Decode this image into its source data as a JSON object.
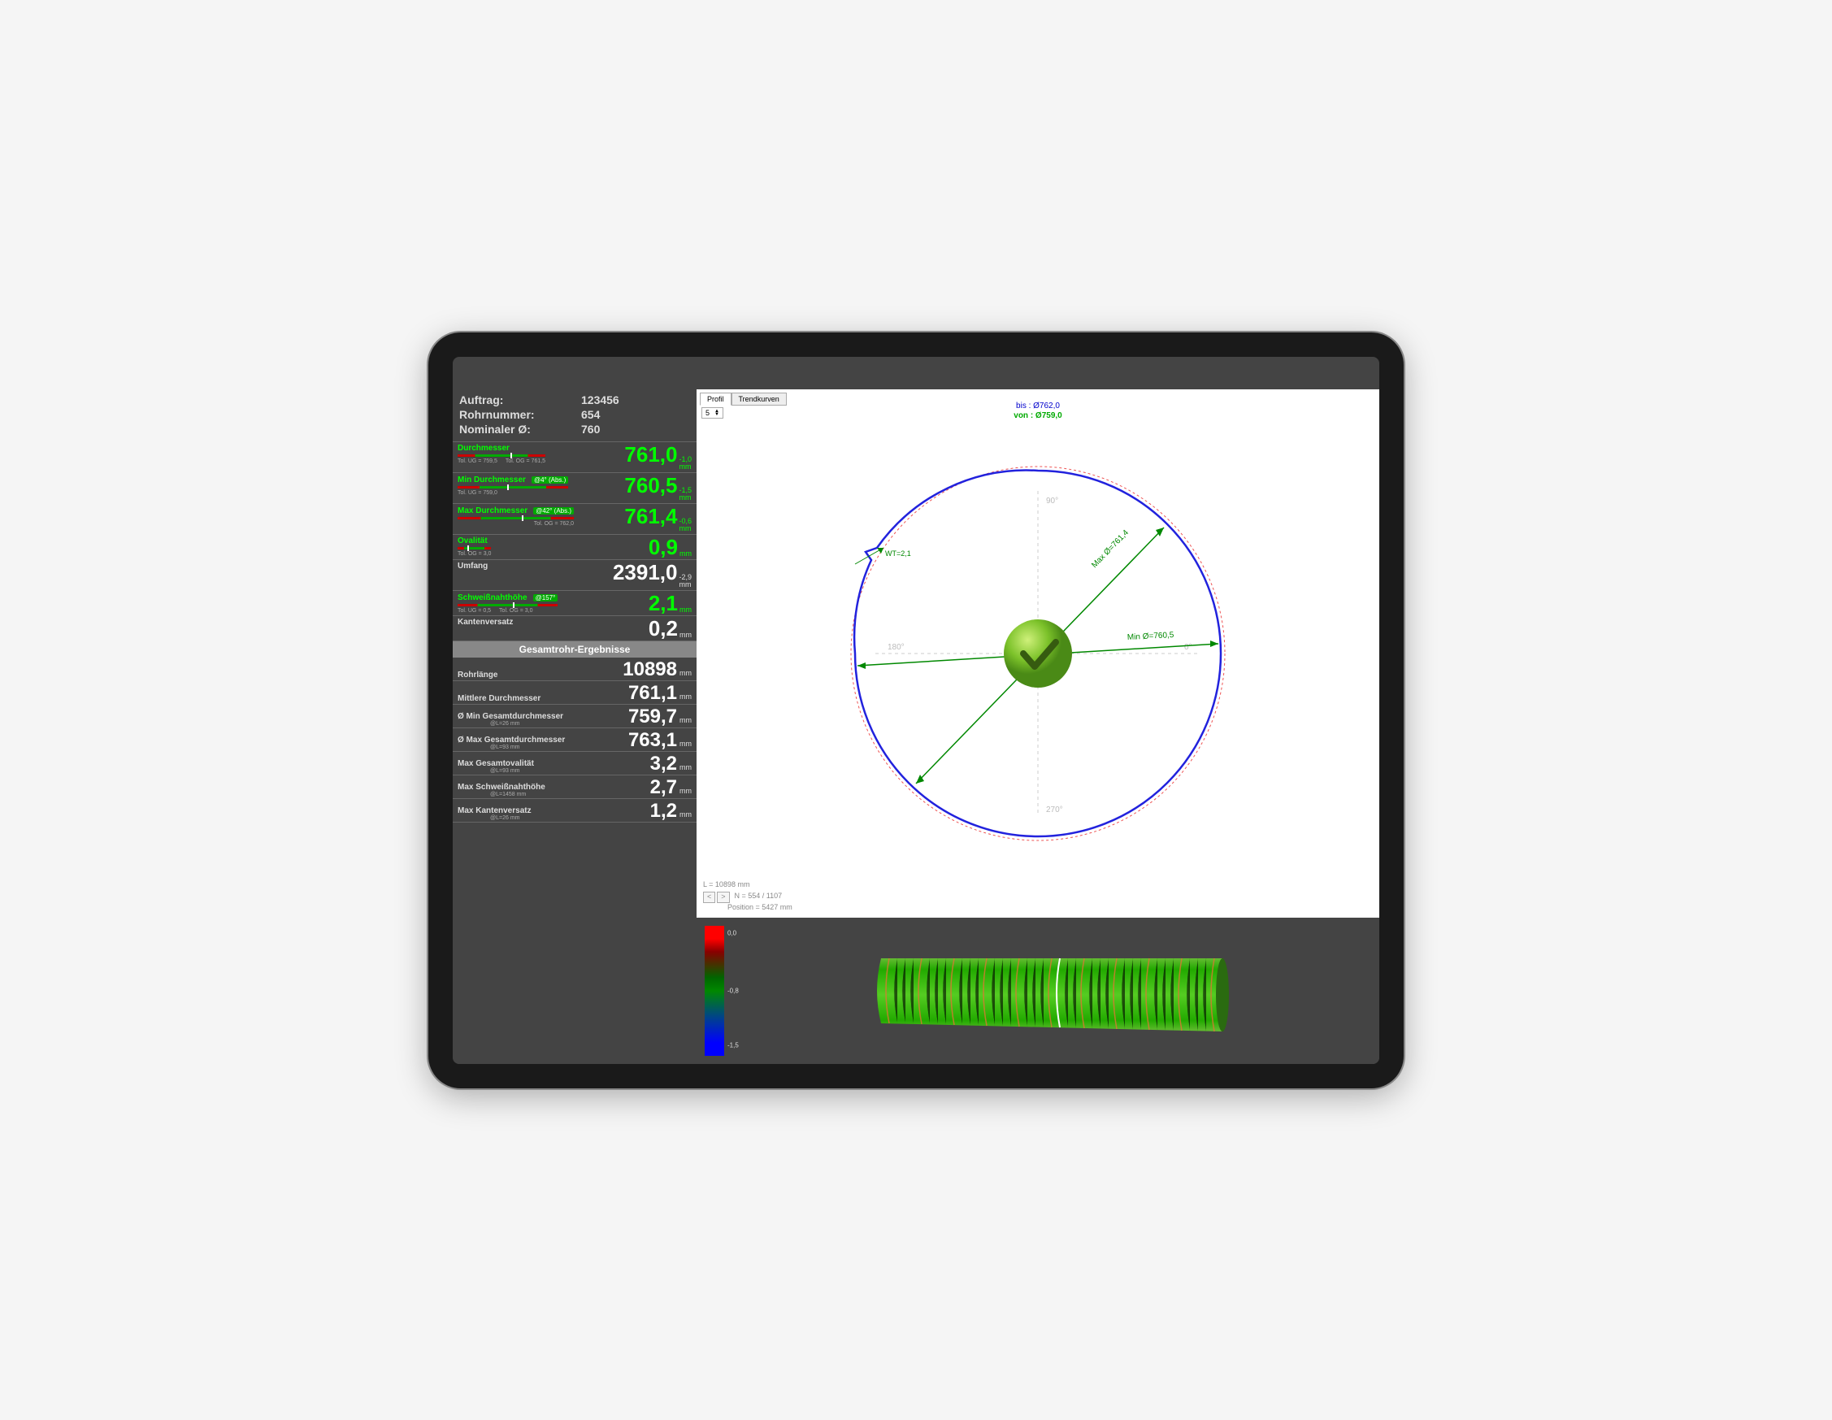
{
  "header": {
    "auftrag_label": "Auftrag:",
    "auftrag_value": "123456",
    "rohr_label": "Rohrnummer:",
    "rohr_value": "654",
    "nominal_label": "Nominaler Ø:",
    "nominal_value": "760"
  },
  "metrics": {
    "durchmesser": {
      "label": "Durchmesser",
      "value": "761,0",
      "dev": "-1,0",
      "unit": "mm",
      "tol_ug": "Tol. UG =  759,5",
      "tol_og": "Tol. OG =  761,5"
    },
    "min_d": {
      "label": "Min Durchmesser",
      "badge": "@4° (Abs.)",
      "value": "760,5",
      "dev": "-1,5",
      "unit": "mm",
      "tol_ug": "Tol. UG =  759,0"
    },
    "max_d": {
      "label": "Max Durchmesser",
      "badge": "@42° (Abs.)",
      "value": "761,4",
      "dev": "-0,6",
      "unit": "mm",
      "tol_og": "Tol. OG =  762,0"
    },
    "oval": {
      "label": "Ovalität",
      "value": "0,9",
      "unit": "mm",
      "tol_og": "Tol. OG =  3,0"
    },
    "umfang": {
      "label": "Umfang",
      "value": "2391,0",
      "dev": "-2,9",
      "unit": "mm"
    },
    "weld": {
      "label": "Schweißnahthöhe",
      "badge": "@157°",
      "value": "2,1",
      "unit": "mm",
      "tol_ug": "Tol. UG =  0,5",
      "tol_og": "Tol. OG =  3,0"
    },
    "kante": {
      "label": "Kantenversatz",
      "value": "0,2",
      "unit": "mm"
    }
  },
  "section_header": "Gesamtrohr-Ergebnisse",
  "results": {
    "rohrlaenge": {
      "label": "Rohrlänge",
      "value": "10898",
      "unit": "mm"
    },
    "mittl_d": {
      "label": "Mittlere Durchmesser",
      "value": "761,1",
      "unit": "mm"
    },
    "min_ges": {
      "label": "Ø Min Gesamtdurchmesser",
      "sub": "@L=26 mm",
      "value": "759,7",
      "unit": "mm"
    },
    "max_ges": {
      "label": "Ø Max Gesamtdurchmesser",
      "sub": "@L=93 mm",
      "value": "763,1",
      "unit": "mm"
    },
    "max_oval": {
      "label": "Max Gesamtovalität",
      "sub": "@L=93 mm",
      "value": "3,2",
      "unit": "mm"
    },
    "max_weld": {
      "label": "Max Schweißnahthöhe",
      "sub": "@L=1458 mm",
      "value": "2,7",
      "unit": "mm"
    },
    "max_kante": {
      "label": "Max Kantenversatz",
      "sub": "@L=26 mm",
      "value": "1,2",
      "unit": "mm"
    }
  },
  "tabs": {
    "profil": "Profil",
    "trend": "Trendkurven"
  },
  "spinner": "5",
  "plot": {
    "bis": "bis : Ø762,0",
    "von": "von : Ø759,0",
    "deg90": "90°",
    "deg180": "180°",
    "deg0": "0°",
    "deg270": "270°",
    "wt": "WT=2,1",
    "max": "Max Ø=761,4",
    "min": "Min Ø=760,5"
  },
  "status": {
    "l": "L = 10898 mm",
    "n": "N = 554 / 1107",
    "pos": "Position = 5427 mm",
    "prev": "<",
    "next": ">"
  },
  "scale": {
    "top": "0,0",
    "mid": "-0,8",
    "bot": "-1,5"
  }
}
